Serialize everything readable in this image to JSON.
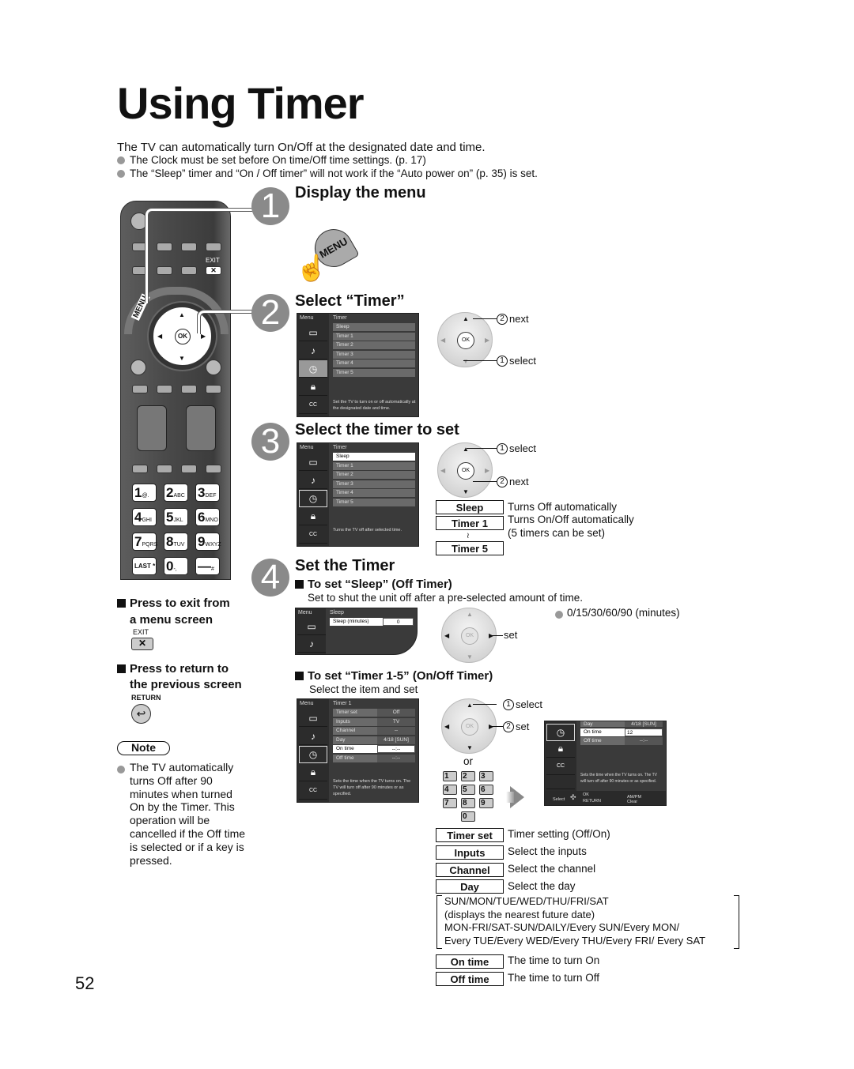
{
  "page": {
    "title": "Using Timer",
    "intro": "The TV can automatically turn On/Off at the designated date and time.",
    "bullets": [
      "The Clock must be set before On time/Off time settings. (p. 17)",
      "The “Sleep” timer and “On / Off timer” will not work if the “Auto power on” (p. 35) is set."
    ],
    "page_number": "52"
  },
  "remote": {
    "exit_label": "EXIT",
    "menu_label": "MENU",
    "ok_label": "OK",
    "keys": [
      {
        "digit": "1",
        "letters": "@."
      },
      {
        "digit": "2",
        "letters": "ABC"
      },
      {
        "digit": "3",
        "letters": "DEF"
      },
      {
        "digit": "4",
        "letters": "GHI"
      },
      {
        "digit": "5",
        "letters": "JKL"
      },
      {
        "digit": "6",
        "letters": "MNO"
      },
      {
        "digit": "7",
        "letters": "PQRS"
      },
      {
        "digit": "8",
        "letters": "TUV"
      },
      {
        "digit": "9",
        "letters": "WXYZ"
      },
      {
        "digit": "LAST",
        "letters": "*"
      },
      {
        "digit": "0",
        "letters": "-,"
      },
      {
        "digit": "—",
        "letters": "#"
      }
    ]
  },
  "sidebar_notes": {
    "exit_heading_1": "Press to exit from",
    "exit_heading_2": "a menu screen",
    "exit_key": "EXIT",
    "return_heading_1": "Press to return to",
    "return_heading_2": "the previous screen",
    "return_key": "RETURN",
    "note_label": "Note",
    "note_text": "The TV automatically turns Off after 90 minutes when turned On by the Timer. This operation will be cancelled if the Off time is selected or if a key is pressed."
  },
  "steps": [
    {
      "number": "1",
      "title": "Display the menu",
      "button_label": "MENU"
    },
    {
      "number": "2",
      "title": "Select “Timer”"
    },
    {
      "number": "3",
      "title": "Select the timer to set"
    },
    {
      "number": "4",
      "title": "Set the Timer"
    }
  ],
  "menu_timer": {
    "menu_header": "Menu",
    "list_header": "Timer",
    "items": [
      "Sleep",
      "Timer 1",
      "Timer 2",
      "Timer 3",
      "Timer 4",
      "Timer 5"
    ],
    "help_step2": "Set the TV to turn on or off automatically at the designated date and time.",
    "help_step3": "Turns the TV off after selected time."
  },
  "step2_callouts": {
    "next": "next",
    "select": "select",
    "n1": "1",
    "n2": "2"
  },
  "step3_callouts": {
    "select": "select",
    "next": "next",
    "n1": "1",
    "n2": "2"
  },
  "timer_keys": [
    {
      "key": "Sleep",
      "desc": "Turns Off automatically"
    },
    {
      "key": "Timer 1",
      "desc": "Turns On/Off automatically"
    },
    {
      "key": "",
      "desc": "(5 timers can be set)"
    },
    {
      "key": "Timer 5",
      "desc": ""
    }
  ],
  "timer_range_mark": "≀",
  "sleep": {
    "heading": "To set “Sleep” (Off Timer)",
    "desc": "Set to shut the unit off after a pre-selected amount of time.",
    "menu_header": "Menu",
    "list_header": "Sleep",
    "field_label": "Sleep (minutes)",
    "field_value": "0",
    "set_label": "set",
    "options": "0/15/30/60/90 (minutes)"
  },
  "onoff": {
    "heading": "To set “Timer 1-5” (On/Off Timer)",
    "desc": "Select the item and set",
    "menu_header": "Menu",
    "list_header": "Timer 1",
    "rows": [
      {
        "label": "Timer set",
        "value": "Off"
      },
      {
        "label": "Inputs",
        "value": "TV"
      },
      {
        "label": "Channel",
        "value": "--"
      },
      {
        "label": "Day",
        "value": "4/18 [SUN]"
      },
      {
        "label": "On time",
        "value": "--:--"
      },
      {
        "label": "Off time",
        "value": "--:--"
      }
    ],
    "help": "Sets the time when the TV turns on. The TV will turn off after 90 minutes or as specified.",
    "select_label": "select",
    "set_label": "set",
    "or_label": "or",
    "n1": "1",
    "n2": "2",
    "small_keys": [
      "1",
      "2",
      "3",
      "4",
      "5",
      "6",
      "7",
      "8",
      "9",
      "0"
    ],
    "result": {
      "day_label": "Day",
      "day_value": "4/18 [SUN]",
      "on_label": "On time",
      "on_value": "12",
      "off_label": "Off time",
      "off_value": "--:--",
      "help": "Sets the time when the TV turns on. The TV will turn off after 90 minutes or as specified.",
      "footer_select": "Select",
      "footer_ok": "OK",
      "footer_return": "RETURN",
      "footer_ampm": "AM/PM",
      "footer_clear": "Clear"
    }
  },
  "item_keys": [
    {
      "key": "Timer set",
      "desc": "Timer setting (Off/On)"
    },
    {
      "key": "Inputs",
      "desc": "Select the inputs"
    },
    {
      "key": "Channel",
      "desc": "Select the channel"
    },
    {
      "key": "Day",
      "desc": "Select the day"
    }
  ],
  "day_options": [
    "SUN/MON/TUE/WED/THU/FRI/SAT",
    "(displays the nearest future date)",
    "MON-FRI/SAT-SUN/DAILY/Every SUN/Every MON/",
    "Every TUE/Every WED/Every THU/Every FRI/ Every SAT"
  ],
  "time_keys": [
    {
      "key": "On time",
      "desc": "The time to turn On"
    },
    {
      "key": "Off time",
      "desc": "The time to turn Off"
    }
  ]
}
